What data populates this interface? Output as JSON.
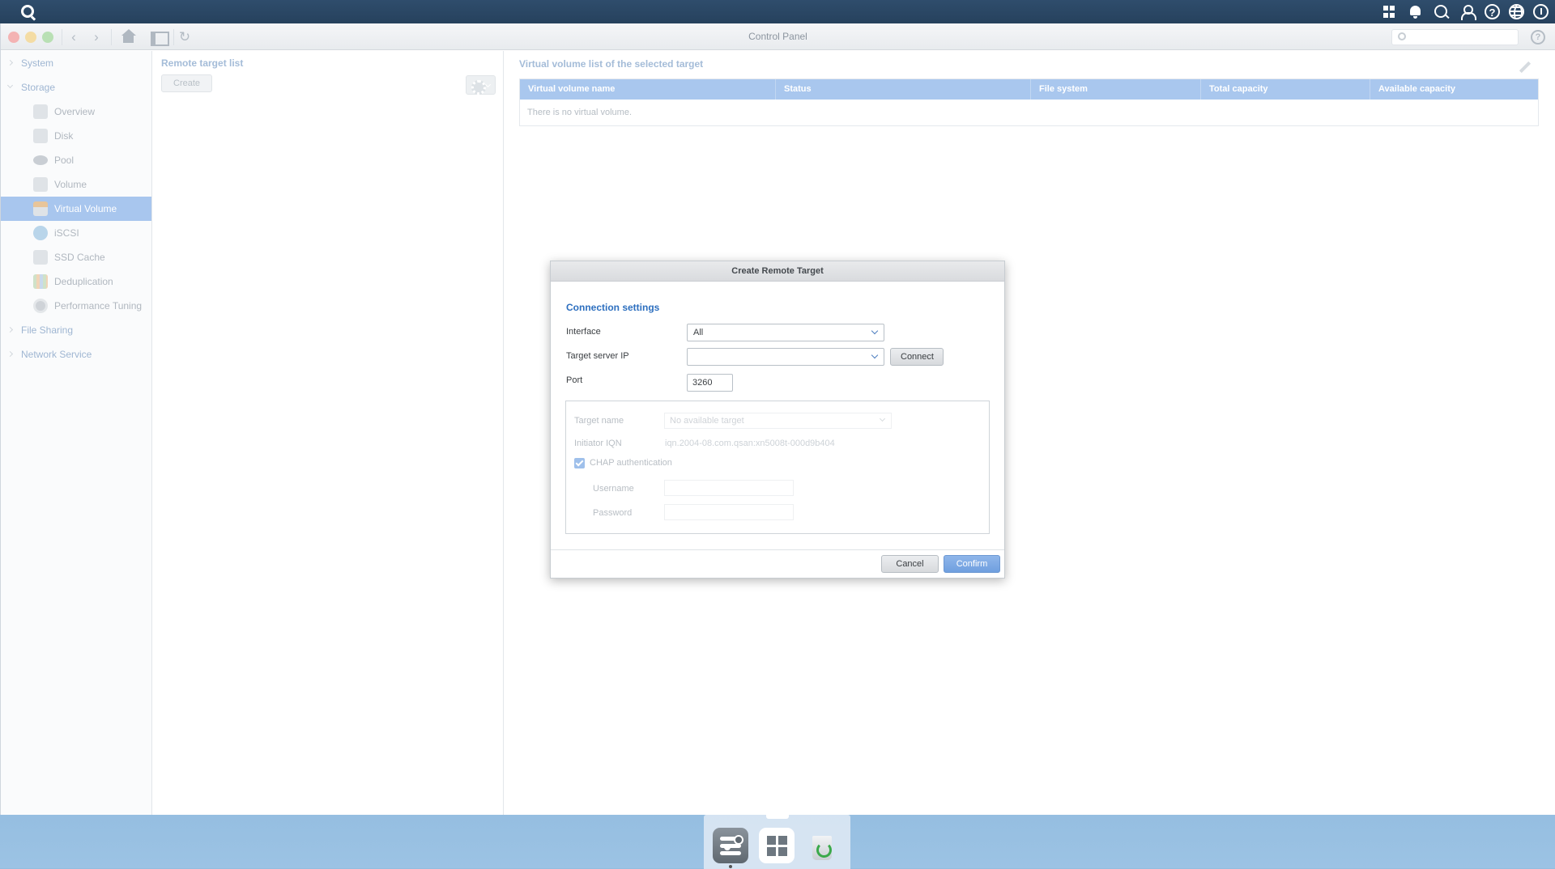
{
  "window": {
    "title": "Control Panel",
    "search_placeholder": ""
  },
  "sidebar": {
    "groups": [
      {
        "label": "System"
      },
      {
        "label": "Storage"
      },
      {
        "label": "File Sharing"
      },
      {
        "label": "Network Service"
      }
    ],
    "storage_items": [
      {
        "label": "Overview"
      },
      {
        "label": "Disk"
      },
      {
        "label": "Pool"
      },
      {
        "label": "Volume"
      },
      {
        "label": "Virtual Volume"
      },
      {
        "label": "iSCSI"
      },
      {
        "label": "SSD Cache"
      },
      {
        "label": "Deduplication"
      },
      {
        "label": "Performance Tuning"
      }
    ],
    "active_item": "Virtual Volume"
  },
  "remote_targets": {
    "title": "Remote target list",
    "create_label": "Create"
  },
  "virtual_volumes": {
    "title": "Virtual volume list of the selected target",
    "columns": [
      "Virtual volume name",
      "Status",
      "File system",
      "Total capacity",
      "Available capacity"
    ],
    "empty_text": "There is no virtual volume."
  },
  "dialog": {
    "title": "Create Remote Target",
    "section_title": "Connection settings",
    "interface_label": "Interface",
    "interface_value": "All",
    "target_ip_label": "Target server IP",
    "target_ip_value": "",
    "connect_label": "Connect",
    "port_label": "Port",
    "port_value": "3260",
    "target_name_label": "Target name",
    "target_name_value": "No available target",
    "initiator_iqn_label": "Initiator IQN",
    "initiator_iqn_value": "iqn.2004-08.com.qsan:xn5008t-000d9b404",
    "chap_label": "CHAP authentication",
    "chap_checked": true,
    "username_label": "Username",
    "username_value": "",
    "password_label": "Password",
    "password_value": "",
    "cancel_label": "Cancel",
    "confirm_label": "Confirm"
  },
  "colors": {
    "accent": "#a8c6ee",
    "section_blue": "#2d6fbf",
    "confirm_blue": "#7fabe5"
  }
}
